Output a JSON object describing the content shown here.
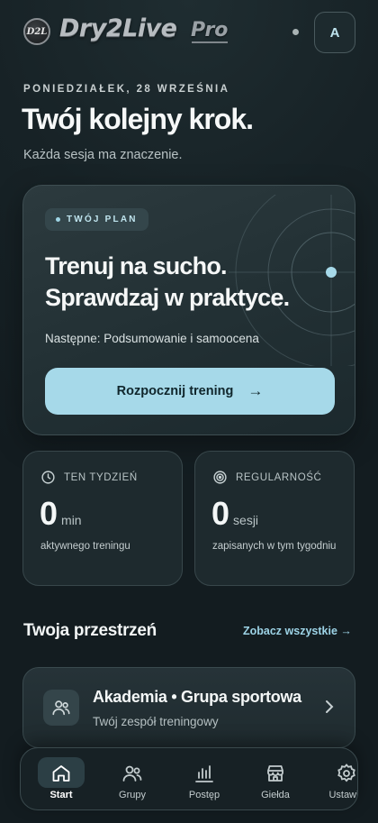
{
  "header": {
    "logo_badge_text": "D2L",
    "logo_word": "Dry2Live",
    "logo_pro": "Pro",
    "avatar_initial": "A"
  },
  "intro": {
    "date": "PONIEDZIAŁEK, 28 WRZEŚNIA",
    "headline": "Twój kolejny krok.",
    "subline": "Każda sesja ma znaczenie."
  },
  "plan_card": {
    "badge": "TWÓJ PLAN",
    "title_line1": "Trenuj na sucho.",
    "title_line2": "Sprawdzaj w praktyce.",
    "next": "Następne: Podsumowanie i samoocena",
    "button_label": "Rozpocznij trening",
    "button_arrow": "→"
  },
  "stats": [
    {
      "icon": "clock-icon",
      "label": "TEN TYDZIEŃ",
      "value": "0",
      "unit": "min",
      "desc": "aktywnego treningu"
    },
    {
      "icon": "target-icon",
      "label": "REGULARNOŚĆ",
      "value": "0",
      "unit": "sesji",
      "desc": "zapisanych w tym tygodniu"
    }
  ],
  "section": {
    "title": "Twoja przestrzeń",
    "see_all": "Zobacz wszystkie →"
  },
  "group": {
    "icon": "users-icon",
    "title": "Akademia • Grupa sportowa",
    "subtitle": "Twój zespół treningowy"
  },
  "tabs": [
    {
      "label": "Start",
      "icon": "home-icon",
      "active": true
    },
    {
      "label": "Grupy",
      "icon": "users-icon",
      "active": false
    },
    {
      "label": "Postęp",
      "icon": "bar-chart-icon",
      "active": false
    },
    {
      "label": "Giełda",
      "icon": "store-icon",
      "active": false
    },
    {
      "label": "Ustawie",
      "icon": "settings-icon",
      "active": false
    }
  ],
  "colors": {
    "accent": "#a6d9e9",
    "background": "#172226",
    "card": "#1e2a2e"
  }
}
